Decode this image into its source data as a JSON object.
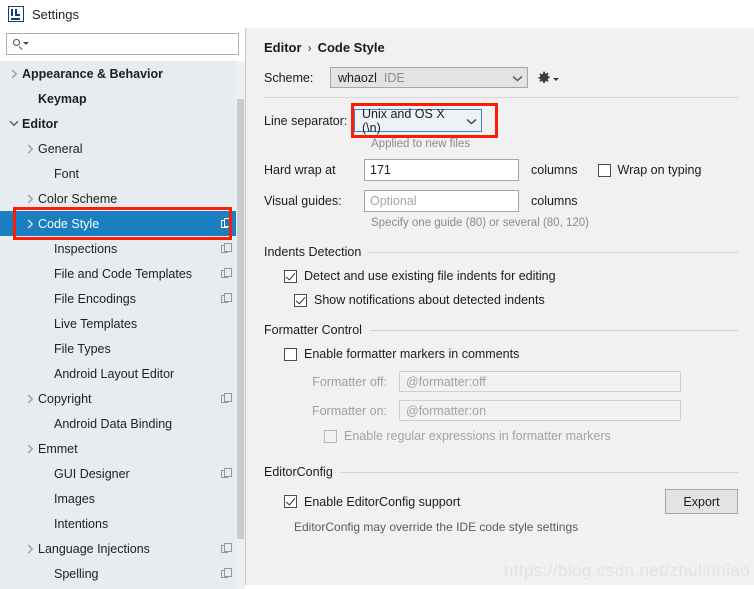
{
  "window": {
    "title": "Settings",
    "app_icon": "intellij-idea-logo-icon"
  },
  "sidebar": {
    "search": {
      "value": "",
      "placeholder": "",
      "icon": "search-icon"
    },
    "items": [
      {
        "label": "Appearance & Behavior",
        "indent": 0,
        "arrow": "right",
        "bold": true,
        "copy_icon": false,
        "selected": false
      },
      {
        "label": "Keymap",
        "indent": 1,
        "arrow": "none",
        "bold": true,
        "copy_icon": false,
        "selected": false
      },
      {
        "label": "Editor",
        "indent": 0,
        "arrow": "down",
        "bold": true,
        "copy_icon": false,
        "selected": false
      },
      {
        "label": "General",
        "indent": 1,
        "arrow": "right",
        "bold": false,
        "copy_icon": false,
        "selected": false
      },
      {
        "label": "Font",
        "indent": 2,
        "arrow": "none",
        "bold": false,
        "copy_icon": false,
        "selected": false
      },
      {
        "label": "Color Scheme",
        "indent": 1,
        "arrow": "right",
        "bold": false,
        "copy_icon": false,
        "selected": false
      },
      {
        "label": "Code Style",
        "indent": 1,
        "arrow": "right",
        "bold": false,
        "copy_icon": true,
        "selected": true
      },
      {
        "label": "Inspections",
        "indent": 2,
        "arrow": "none",
        "bold": false,
        "copy_icon": true,
        "selected": false
      },
      {
        "label": "File and Code Templates",
        "indent": 2,
        "arrow": "none",
        "bold": false,
        "copy_icon": true,
        "selected": false
      },
      {
        "label": "File Encodings",
        "indent": 2,
        "arrow": "none",
        "bold": false,
        "copy_icon": true,
        "selected": false
      },
      {
        "label": "Live Templates",
        "indent": 2,
        "arrow": "none",
        "bold": false,
        "copy_icon": false,
        "selected": false
      },
      {
        "label": "File Types",
        "indent": 2,
        "arrow": "none",
        "bold": false,
        "copy_icon": false,
        "selected": false
      },
      {
        "label": "Android Layout Editor",
        "indent": 2,
        "arrow": "none",
        "bold": false,
        "copy_icon": false,
        "selected": false
      },
      {
        "label": "Copyright",
        "indent": 1,
        "arrow": "right",
        "bold": false,
        "copy_icon": true,
        "selected": false
      },
      {
        "label": "Android Data Binding",
        "indent": 2,
        "arrow": "none",
        "bold": false,
        "copy_icon": false,
        "selected": false
      },
      {
        "label": "Emmet",
        "indent": 1,
        "arrow": "right",
        "bold": false,
        "copy_icon": false,
        "selected": false
      },
      {
        "label": "GUI Designer",
        "indent": 2,
        "arrow": "none",
        "bold": false,
        "copy_icon": true,
        "selected": false
      },
      {
        "label": "Images",
        "indent": 2,
        "arrow": "none",
        "bold": false,
        "copy_icon": false,
        "selected": false
      },
      {
        "label": "Intentions",
        "indent": 2,
        "arrow": "none",
        "bold": false,
        "copy_icon": false,
        "selected": false
      },
      {
        "label": "Language Injections",
        "indent": 1,
        "arrow": "right",
        "bold": false,
        "copy_icon": true,
        "selected": false
      },
      {
        "label": "Spelling",
        "indent": 2,
        "arrow": "none",
        "bold": false,
        "copy_icon": true,
        "selected": false
      }
    ]
  },
  "main": {
    "breadcrumb": {
      "parent": "Editor",
      "separator": "›",
      "current": "Code Style"
    },
    "scheme": {
      "label": "Scheme:",
      "value": "whaozl",
      "kind": "IDE",
      "gear_icon": "gear-icon"
    },
    "line_separator": {
      "label": "Line separator:",
      "value": "Unix and OS X (\\n)",
      "hint": "Applied to new files"
    },
    "hard_wrap": {
      "label": "Hard wrap at",
      "value": "171",
      "unit": "columns"
    },
    "wrap_on_typing": {
      "label": "Wrap on typing",
      "checked": false
    },
    "visual_guides": {
      "label": "Visual guides:",
      "value": "",
      "placeholder": "Optional",
      "unit": "columns",
      "hint": "Specify one guide (80) or several (80, 120)"
    },
    "indents_detection": {
      "title": "Indents Detection",
      "detect_use": {
        "label": "Detect and use existing file indents for editing",
        "checked": true
      },
      "show_notifications": {
        "label": "Show notifications about detected indents",
        "checked": true
      }
    },
    "formatter_control": {
      "title": "Formatter Control",
      "enable_markers": {
        "label": "Enable formatter markers in comments",
        "checked": false
      },
      "formatter_off": {
        "label": "Formatter off:",
        "value": "",
        "placeholder": "@formatter:off"
      },
      "formatter_on": {
        "label": "Formatter on:",
        "value": "",
        "placeholder": "@formatter:on"
      },
      "enable_regex": {
        "label": "Enable regular expressions in formatter markers",
        "checked": false
      }
    },
    "editorconfig": {
      "title": "EditorConfig",
      "enable_support": {
        "label": "Enable EditorConfig support",
        "checked": true
      },
      "export_button": "Export",
      "hint": "EditorConfig may override the IDE code style settings"
    }
  },
  "annotations": {
    "highlight_color": "#fc1b07"
  },
  "watermark": "https://blog.csdn.net/zhulinniao"
}
